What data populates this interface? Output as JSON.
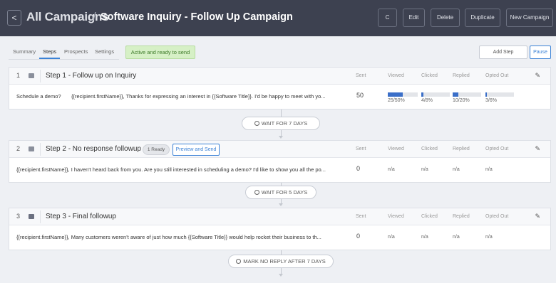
{
  "header": {
    "back_glyph": "<",
    "root_crumb": "All Campaigns",
    "sep": "/",
    "title": "Software Inquiry - Follow Up Campaign",
    "buttons": {
      "refresh_glyph": "C",
      "edit": "Edit",
      "delete": "Delete",
      "duplicate": "Duplicate",
      "new_campaign": "New Campaign"
    }
  },
  "tabs": {
    "summary": "Summary",
    "steps": "Steps",
    "prospects": "Prospects",
    "settings": "Settings"
  },
  "status": "Active and ready to send",
  "actions": {
    "add_step": "Add Step",
    "pause": "Pause"
  },
  "columns": {
    "sent": "Sent",
    "viewed": "Viewed",
    "clicked": "Clicked",
    "replied": "Replied",
    "opted_out": "Opted Out"
  },
  "steps": [
    {
      "num": "1",
      "title": "Step 1 - Follow up on Inquiry",
      "subject": "Schedule a demo?",
      "body": "{{recipient.firstName}}, Thanks for expressing an interest in {{Software Title}}. I'd be happy to meet with yo...",
      "sent": "50",
      "viewed": {
        "label": "25/50%",
        "pct": 50
      },
      "clicked": {
        "label": "4/8%",
        "pct": 8
      },
      "replied": {
        "label": "10/20%",
        "pct": 20
      },
      "opted_out": {
        "label": "3/6%",
        "pct": 6
      }
    },
    {
      "num": "2",
      "title": "Step 2 - No response followup",
      "ready": "1 Ready",
      "preview": "Preview and Send",
      "body": "{{recipient.firstName}}, I haven't heard back from you. Are you still interested in scheduling a demo? I'd like to show you all the po...",
      "sent": "0",
      "viewed": "n/a",
      "clicked": "n/a",
      "replied": "n/a",
      "opted_out": "n/a"
    },
    {
      "num": "3",
      "title": "Step 3 - Final followup",
      "body": "{{recipient.firstName}}, Many customers weren't aware of just how much {{Software Title}} would help rocket their business to th...",
      "sent": "0",
      "viewed": "n/a",
      "clicked": "n/a",
      "replied": "n/a",
      "opted_out": "n/a"
    }
  ],
  "waits": {
    "w1": "WAIT FOR 7 DAYS",
    "w2": "WAIT FOR 5 DAYS",
    "w3": "MARK NO REPLY AFTER 7 DAYS"
  },
  "icons": {
    "back": "chevron-left-icon",
    "refresh": "refresh-icon",
    "edit": "pencil-icon",
    "clock": "clock-icon",
    "mail": "envelope-icon"
  },
  "colors": {
    "header_bg": "#3d4150",
    "accent": "#3b82d6",
    "active_status_bg": "#d6f0c6",
    "bar_fill": "#3b6fc8"
  }
}
